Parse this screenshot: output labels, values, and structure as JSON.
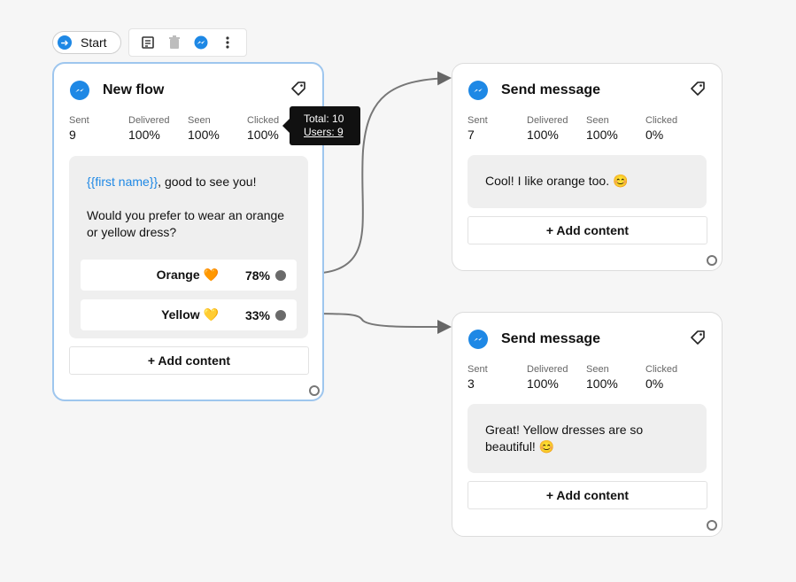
{
  "start": {
    "label": "Start"
  },
  "toolbar": {
    "icons": [
      "note-icon",
      "trash-icon",
      "messenger-icon",
      "more-icon"
    ]
  },
  "tooltip": {
    "total": "Total: 10",
    "users": "Users: 9"
  },
  "stat_labels": {
    "sent": "Sent",
    "delivered": "Delivered",
    "seen": "Seen",
    "clicked": "Clicked"
  },
  "cards": [
    {
      "title": "New flow",
      "stats": {
        "sent": "9",
        "delivered": "100%",
        "seen": "100%",
        "clicked": "100%"
      },
      "message_var": "{{first name}}",
      "message_line1_rest": ", good to see you!",
      "message_para2_line1": "Would you prefer to wear an orange",
      "message_para2_line2": "or yellow dress?",
      "buttons": [
        {
          "label": "Orange 🧡",
          "percent": "78%"
        },
        {
          "label": "Yellow 💛",
          "percent": "33%"
        }
      ],
      "add_content": "+ Add content"
    },
    {
      "title": "Send message",
      "stats": {
        "sent": "7",
        "delivered": "100%",
        "seen": "100%",
        "clicked": "0%"
      },
      "message": "Cool! I like orange too. 😊",
      "add_content": "+ Add content"
    },
    {
      "title": "Send message",
      "stats": {
        "sent": "3",
        "delivered": "100%",
        "seen": "100%",
        "clicked": "0%"
      },
      "message_line1": "Great! Yellow dresses are so",
      "message_line2": "beautiful! 😊",
      "add_content": "+ Add content"
    }
  ],
  "colors": {
    "accent": "#1e88e5",
    "selected_border": "#9ec6ee",
    "canvas": "#f6f6f6"
  }
}
